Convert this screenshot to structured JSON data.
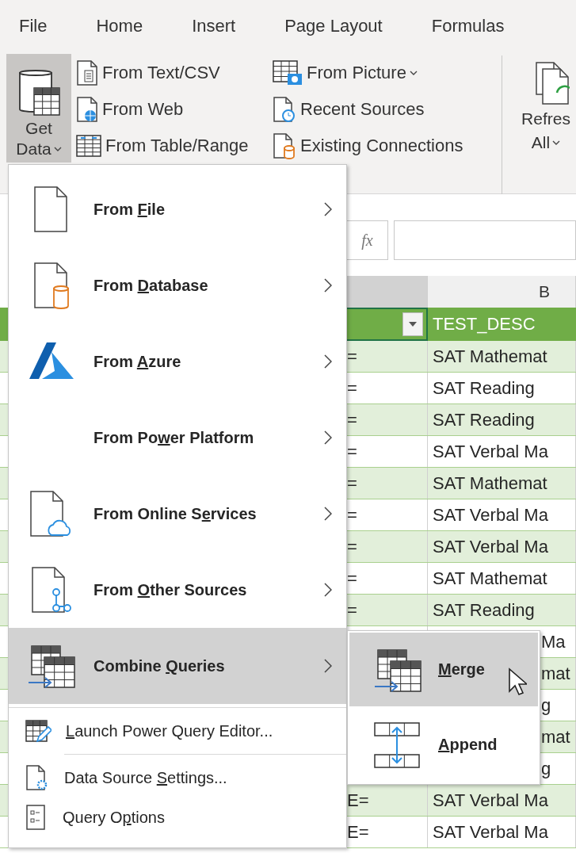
{
  "ribbon_tabs": [
    {
      "label": "File"
    },
    {
      "label": "Home"
    },
    {
      "label": "Insert"
    },
    {
      "label": "Page Layout"
    },
    {
      "label": "Formulas"
    }
  ],
  "ribbon": {
    "get_data": {
      "label_lines": [
        "Get",
        "Data"
      ],
      "pressed": true,
      "has_dropdown": true
    },
    "columns": [
      [
        {
          "label": "From Text/CSV"
        },
        {
          "label": "From Web"
        },
        {
          "label": "From Table/Range"
        }
      ],
      [
        {
          "label": "From Picture",
          "has_dropdown": true
        },
        {
          "label": "Recent Sources"
        },
        {
          "label": "Existing Connections"
        }
      ]
    ],
    "refresh_all": {
      "label_lines": [
        "Refres",
        "All"
      ],
      "has_dropdown": true
    }
  },
  "sheet": {
    "formula_bar": {
      "fx": "fx"
    },
    "column_headers": [
      {
        "selected": true
      },
      {
        "label": "B",
        "selected": false
      }
    ],
    "header_row": [
      {
        "filter": true,
        "selected": true
      },
      {
        "label": "TEST_DESC",
        "selected": false
      }
    ],
    "rows": [
      {
        "a": "=",
        "b": "SAT Mathemat",
        "banded": true
      },
      {
        "a": "=",
        "b": "SAT Reading",
        "banded": false
      },
      {
        "a": "=",
        "b": "SAT Reading",
        "banded": true
      },
      {
        "a": "=",
        "b": "SAT Verbal Ma",
        "banded": false
      },
      {
        "a": "=",
        "b": "SAT Mathemat",
        "banded": true
      },
      {
        "a": "=",
        "b": "SAT Verbal Ma",
        "banded": false
      },
      {
        "a": "=",
        "b": "SAT Verbal Ma",
        "banded": true
      },
      {
        "a": "=",
        "b": "SAT Mathemat",
        "banded": false
      },
      {
        "a": "=",
        "b": "SAT Reading",
        "banded": true
      },
      {
        "b": "Ma",
        "banded": false,
        "b_clipped_left": true
      },
      {
        "b": "mat",
        "banded": true,
        "b_clipped_left": true
      },
      {
        "b": "g",
        "banded": false,
        "b_clipped_left": true
      },
      {
        "b": "mat",
        "banded": true,
        "b_clipped_left": true
      },
      {
        "b": "g",
        "banded": false,
        "b_clipped_left": true
      },
      {
        "a": "E=",
        "b": "SAT Verbal Ma",
        "banded": true
      },
      {
        "a": "E=",
        "b": "SAT Verbal Ma",
        "banded": false
      }
    ]
  },
  "get_data_menu": {
    "items": [
      {
        "kind": "large",
        "label_before": "From ",
        "access_key": "F",
        "label_after": "ile",
        "has_submenu": true,
        "selected": false
      },
      {
        "kind": "large",
        "label_before": "From ",
        "access_key": "D",
        "label_after": "atabase",
        "has_submenu": true,
        "selected": false
      },
      {
        "kind": "large",
        "label_before": "From ",
        "access_key": "A",
        "label_after": "zure",
        "has_submenu": true,
        "selected": false
      },
      {
        "kind": "large",
        "label_before": "From Po",
        "access_key": "w",
        "label_after": "er Platform",
        "has_submenu": true,
        "selected": false
      },
      {
        "kind": "large",
        "label_before": "From Online S",
        "access_key": "e",
        "label_after": "rvices",
        "has_submenu": true,
        "selected": false
      },
      {
        "kind": "large",
        "label_before": "From ",
        "access_key": "O",
        "label_after": "ther Sources",
        "has_submenu": true,
        "selected": false
      },
      {
        "kind": "large",
        "label_before": "Combine ",
        "access_key": "Q",
        "label_after": "ueries",
        "has_submenu": true,
        "selected": true
      },
      {
        "kind": "separator"
      },
      {
        "kind": "small",
        "access_key": "L",
        "label_after": "aunch Power Query Editor...",
        "selected": false
      },
      {
        "kind": "separator"
      },
      {
        "kind": "small",
        "label_before": "Data Source ",
        "access_key": "S",
        "label_after": "ettings...",
        "selected": false
      },
      {
        "kind": "small",
        "label_before": "Query O",
        "access_key": "p",
        "label_after": "tions",
        "selected": false
      }
    ]
  },
  "combine_submenu": {
    "items": [
      {
        "access_key": "M",
        "label_after": "erge",
        "selected": true
      },
      {
        "access_key": "A",
        "label_after": "ppend",
        "selected": false
      }
    ]
  }
}
